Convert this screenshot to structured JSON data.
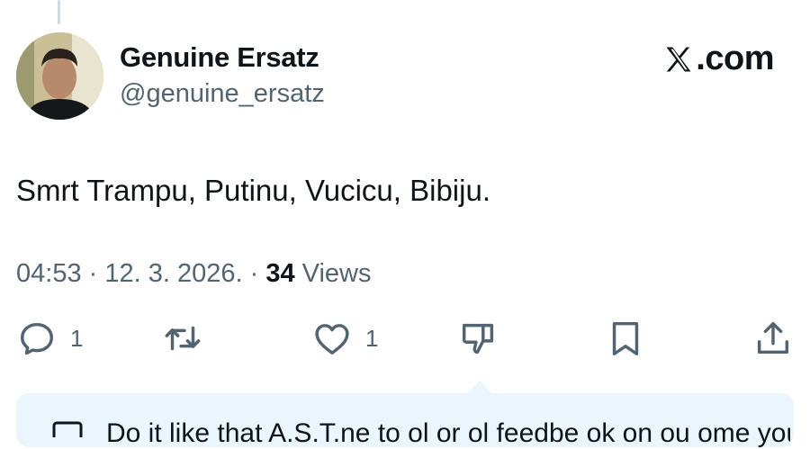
{
  "tweet": {
    "author": {
      "display_name": "Genuine Ersatz",
      "handle": "@genuine_ersatz"
    },
    "brand": ".com",
    "brand_icon": "x-logo-icon",
    "text": "Smrt Trampu, Putinu, Vucicu, Bibiju.",
    "meta": {
      "time": "04:53",
      "separator": " · ",
      "date": "12. 3. 2026.",
      "views_count": "34",
      "views_label": " Views"
    },
    "actions": {
      "reply": {
        "icon": "reply-icon",
        "count": "1"
      },
      "retweet": {
        "icon": "retweet-icon"
      },
      "like": {
        "icon": "heart-icon",
        "count": "1"
      },
      "dislike": {
        "icon": "thumbs-down-icon"
      },
      "bookmark": {
        "icon": "bookmark-icon"
      },
      "share": {
        "icon": "share-icon"
      }
    },
    "note_text": "Do it like that A.S.T.ne to ol or ol feedbe ok on ou ome you out le"
  },
  "colors": {
    "text": "#0f1419",
    "secondary": "#536471",
    "note_bg": "#eaf6fb"
  }
}
